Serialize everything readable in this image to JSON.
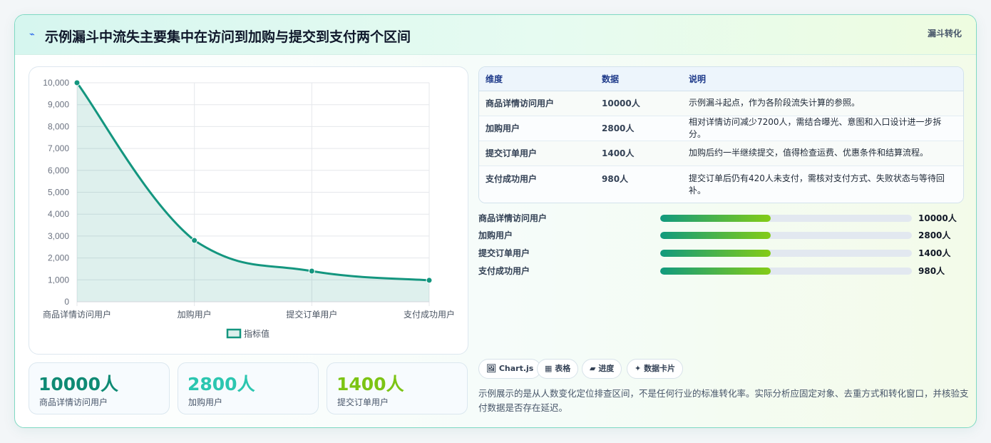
{
  "header": {
    "title": "示例漏斗中流失主要集中在访问到加购与提交到支付两个区间",
    "tag": "漏斗转化",
    "icon": "lightning-icon"
  },
  "chart_data": {
    "type": "line",
    "categories": [
      "商品详情访问用户",
      "加购用户",
      "提交订单用户",
      "支付成功用户"
    ],
    "series": [
      {
        "name": "指标值",
        "values": [
          10000,
          2800,
          1400,
          980
        ]
      }
    ],
    "ylim": [
      0,
      10000
    ],
    "yticks": [
      "0",
      "1,000",
      "2,000",
      "3,000",
      "4,000",
      "5,000",
      "6,000",
      "7,000",
      "8,000",
      "9,000",
      "10,000"
    ],
    "legend": "bottom",
    "grid": true,
    "fill": true,
    "color": "#14967f"
  },
  "kpis": [
    {
      "value": "10000人",
      "label": "商品详情访问用户",
      "color": "#0f8a74"
    },
    {
      "value": "2800人",
      "label": "加购用户",
      "color": "#2cc6b0"
    },
    {
      "value": "1400人",
      "label": "提交订单用户",
      "color": "#7cc414"
    }
  ],
  "table": {
    "headers": [
      "维度",
      "数据",
      "说明"
    ],
    "rows": [
      [
        "商品详情访问用户",
        "10000人",
        "示例漏斗起点，作为各阶段流失计算的参照。"
      ],
      [
        "加购用户",
        "2800人",
        "相对详情访问减少7200人，需结合曝光、意图和入口设计进一步拆分。"
      ],
      [
        "提交订单用户",
        "1400人",
        "加购后约一半继续提交，值得检查运费、优惠条件和结算流程。"
      ],
      [
        "支付成功用户",
        "980人",
        "提交订单后仍有420人未支付，需核对支付方式、失败状态与等待回补。"
      ]
    ]
  },
  "progress": [
    {
      "label": "商品详情访问用户",
      "value": "10000人",
      "fraction": 0.44
    },
    {
      "label": "加购用户",
      "value": "2800人",
      "fraction": 0.44
    },
    {
      "label": "提交订单用户",
      "value": "1400人",
      "fraction": 0.44
    },
    {
      "label": "支付成功用户",
      "value": "980人",
      "fraction": 0.44
    }
  ],
  "chips": [
    {
      "icon": "🖼",
      "label": "Chart.js"
    },
    {
      "icon": "▦",
      "label": "表格"
    },
    {
      "icon": "▰",
      "label": "进度"
    },
    {
      "icon": "✦",
      "label": "数据卡片"
    }
  ],
  "note": "示例展示的是从人数变化定位排查区间，不是任何行业的标准转化率。实际分析应固定对象、去重方式和转化窗口，并核验支付数据是否存在延迟。"
}
